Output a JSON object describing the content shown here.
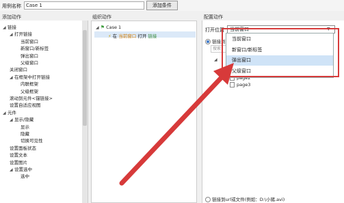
{
  "top": {
    "case_name_label": "用例名称",
    "case_name_value": "Case 1",
    "add_condition_button": "添加条件"
  },
  "headers": {
    "left": "添加动作",
    "middle": "组织动作",
    "right": "配置动作"
  },
  "left_tree": [
    {
      "label": "链接",
      "level": 0,
      "expanded": true
    },
    {
      "label": "打开链接",
      "level": 1,
      "expanded": true
    },
    {
      "label": "当前窗口",
      "level": 2
    },
    {
      "label": "新窗口/新标签",
      "level": 2
    },
    {
      "label": "弹出窗口",
      "level": 2
    },
    {
      "label": "父级窗口",
      "level": 2
    },
    {
      "label": "关闭窗口",
      "level": 1
    },
    {
      "label": "在框架中打开链接",
      "level": 1,
      "expanded": true
    },
    {
      "label": "内联框架",
      "level": 2
    },
    {
      "label": "父级框架",
      "level": 2
    },
    {
      "label": "滚动到元件<锚链接>",
      "level": 1
    },
    {
      "label": "设置自适应视图",
      "level": 1
    },
    {
      "label": "元件",
      "level": 0,
      "expanded": true
    },
    {
      "label": "显示/隐藏",
      "level": 1,
      "expanded": true
    },
    {
      "label": "显示",
      "level": 2
    },
    {
      "label": "隐藏",
      "level": 2
    },
    {
      "label": "切换可见性",
      "level": 2
    },
    {
      "label": "设置面板状态",
      "level": 1
    },
    {
      "label": "设置文本",
      "level": 1
    },
    {
      "label": "设置图片",
      "level": 1
    },
    {
      "label": "设置选中",
      "level": 1,
      "expanded": true
    },
    {
      "label": "选中",
      "level": 2
    }
  ],
  "middle": {
    "case_label": "Case 1",
    "action_prefix": "在",
    "action_target": "当前窗口",
    "action_verb": "打开",
    "action_object": "链接"
  },
  "right": {
    "open_in_label": "打开位置",
    "selected_option": "当前窗口",
    "options": [
      "当前窗口",
      "新窗口/新标签",
      "弹出窗口",
      "父级窗口"
    ],
    "highlighted_option": "弹出窗口",
    "link_radio_label": "链接到",
    "search_placeholder": "搜索",
    "pages": [
      "page2",
      "page3"
    ],
    "url_radio_label": "链接到url或文件(例如：D:\\小猪.avi)"
  },
  "colors": {
    "highlight_border": "#d73a3a",
    "arrow": "#d73a3a",
    "selection_bg": "#cfe3f7",
    "action_target_color": "#d07a00"
  }
}
